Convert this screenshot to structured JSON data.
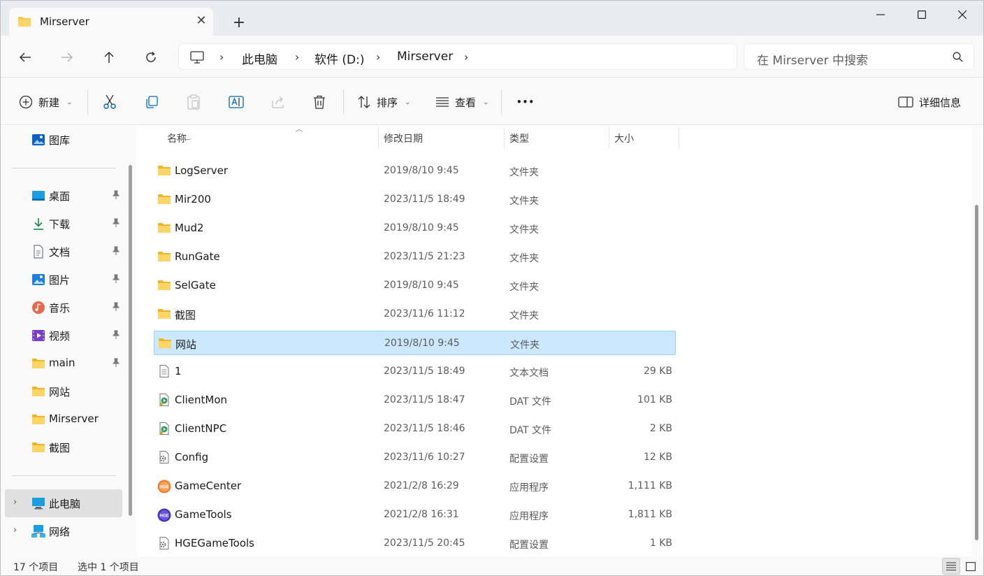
{
  "window": {
    "tab_title": "Mirserver",
    "new_tab_symbol": "+",
    "close_symbol": "✕"
  },
  "address": {
    "crumbs": [
      "此电脑",
      "软件 (D:)",
      "Mirserver"
    ],
    "search_placeholder": "在 Mirserver 中搜索"
  },
  "toolbar": {
    "new_label": "新建",
    "sort_label": "排序",
    "view_label": "查看",
    "more_label": "•••",
    "details_label": "详细信息"
  },
  "sidebar": {
    "gallery": "图库",
    "pinned": [
      "桌面",
      "下载",
      "文档",
      "图片",
      "音乐",
      "视频",
      "main",
      "网站",
      "Mirserver",
      "截图"
    ],
    "this_pc": "此电脑",
    "network": "网络"
  },
  "columns": {
    "name": "名称",
    "modified": "修改日期",
    "type": "类型",
    "size": "大小"
  },
  "files": [
    {
      "name": "LogServer",
      "date": "2019/8/10 9:45",
      "type": "文件夹",
      "size": "",
      "icon": "folder-icon"
    },
    {
      "name": "Mir200",
      "date": "2023/11/5 18:49",
      "type": "文件夹",
      "size": "",
      "icon": "folder-icon"
    },
    {
      "name": "Mud2",
      "date": "2019/8/10 9:45",
      "type": "文件夹",
      "size": "",
      "icon": "folder-icon"
    },
    {
      "name": "RunGate",
      "date": "2023/11/5 21:23",
      "type": "文件夹",
      "size": "",
      "icon": "folder-icon"
    },
    {
      "name": "SelGate",
      "date": "2019/8/10 9:45",
      "type": "文件夹",
      "size": "",
      "icon": "folder-icon"
    },
    {
      "name": "截图",
      "date": "2023/11/6 11:12",
      "type": "文件夹",
      "size": "",
      "icon": "folder-icon"
    },
    {
      "name": "网站",
      "date": "2019/8/10 9:45",
      "type": "文件夹",
      "size": "",
      "icon": "folder-icon",
      "selected": true
    },
    {
      "name": "1",
      "date": "2023/11/5 18:49",
      "type": "文本文档",
      "size": "29 KB",
      "icon": "text-file-icon"
    },
    {
      "name": "ClientMon",
      "date": "2023/11/5 18:47",
      "type": "DAT 文件",
      "size": "101 KB",
      "icon": "media-file-icon"
    },
    {
      "name": "ClientNPC",
      "date": "2023/11/5 18:46",
      "type": "DAT 文件",
      "size": "2 KB",
      "icon": "media-file-icon"
    },
    {
      "name": "Config",
      "date": "2023/11/6 10:27",
      "type": "配置设置",
      "size": "12 KB",
      "icon": "config-file-icon"
    },
    {
      "name": "GameCenter",
      "date": "2021/2/8 16:29",
      "type": "应用程序",
      "size": "1,111 KB",
      "icon": "app-orange-icon"
    },
    {
      "name": "GameTools",
      "date": "2021/2/8 16:31",
      "type": "应用程序",
      "size": "1,811 KB",
      "icon": "app-purple-icon"
    },
    {
      "name": "HGEGameTools",
      "date": "2023/11/5 20:45",
      "type": "配置设置",
      "size": "1 KB",
      "icon": "config-file-icon"
    }
  ],
  "status": {
    "count": "17 个项目",
    "selected": "选中 1 个项目"
  },
  "colors": {
    "selection": "#cce8ff",
    "folder": "#f8c94c",
    "accent": "#0067c0"
  }
}
